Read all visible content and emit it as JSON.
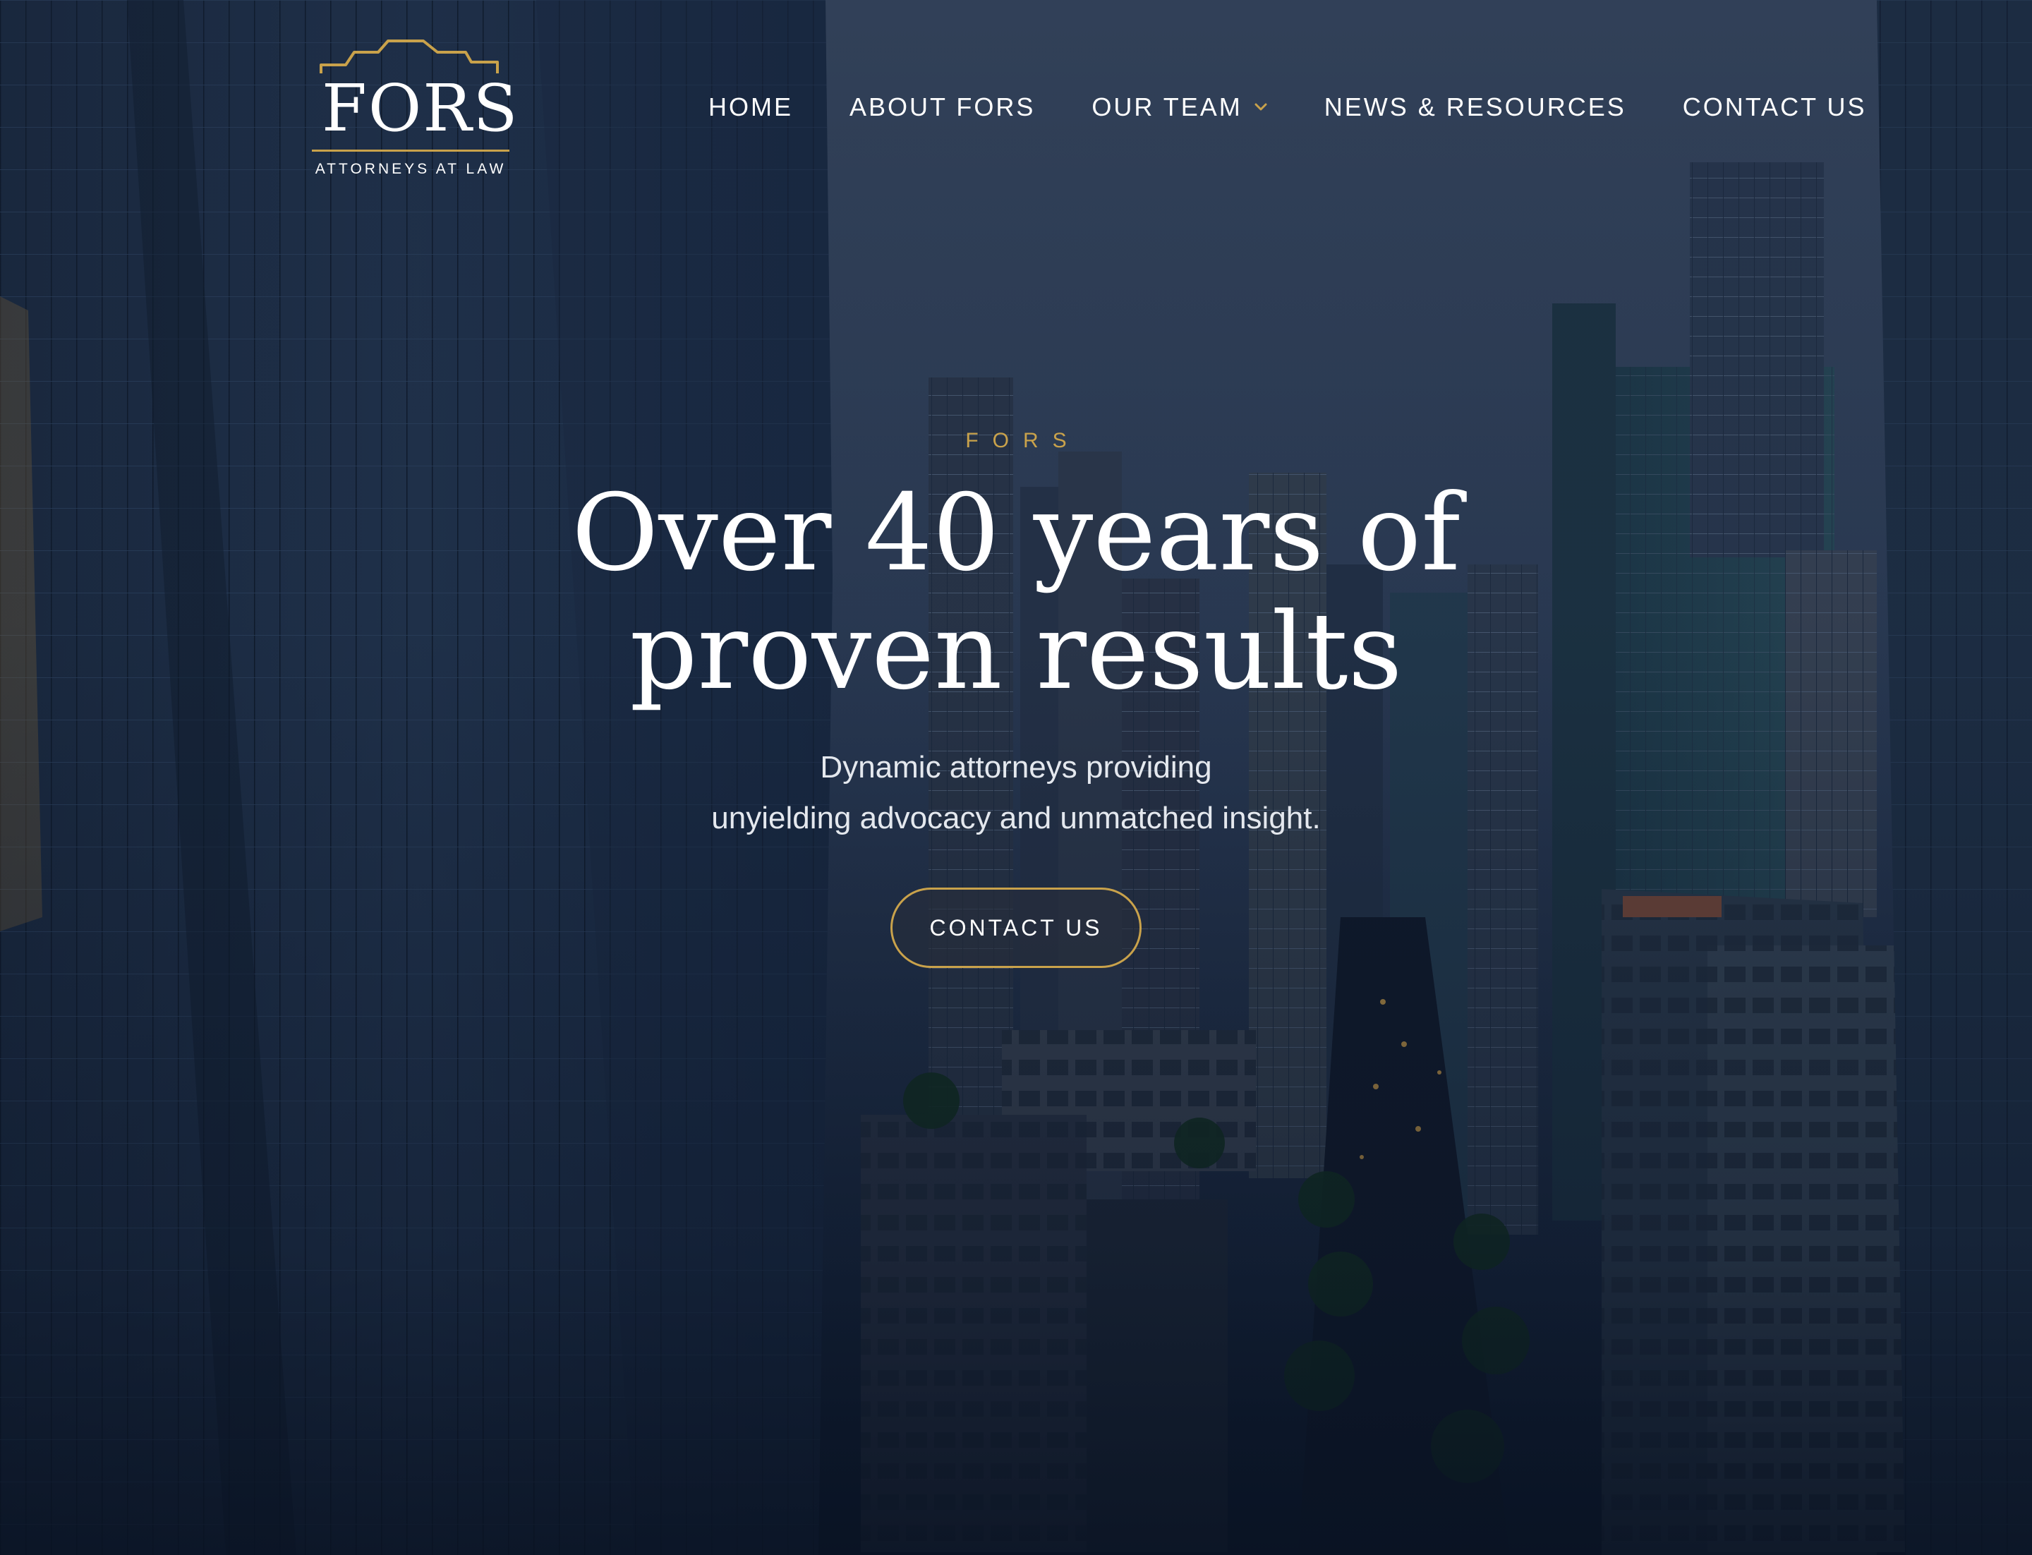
{
  "logo": {
    "wordmark": "FORS",
    "tagline": "ATTORNEYS AT LAW"
  },
  "nav": {
    "items": [
      {
        "label": "HOME"
      },
      {
        "label": "ABOUT FORS"
      },
      {
        "label": "OUR TEAM",
        "has_dropdown": true
      },
      {
        "label": "NEWS & RESOURCES"
      },
      {
        "label": "CONTACT US"
      }
    ]
  },
  "hero": {
    "eyebrow": "FORS",
    "headline_line1": "Over 40 years of",
    "headline_line2": "proven results",
    "sub_line1": "Dynamic attorneys providing",
    "sub_line2": "unyielding advocacy and unmatched insight.",
    "cta_label": "CONTACT US"
  },
  "colors": {
    "accent_gold": "#c9a24b",
    "text_white": "#ffffff",
    "background_navy": "#0e1c31"
  }
}
